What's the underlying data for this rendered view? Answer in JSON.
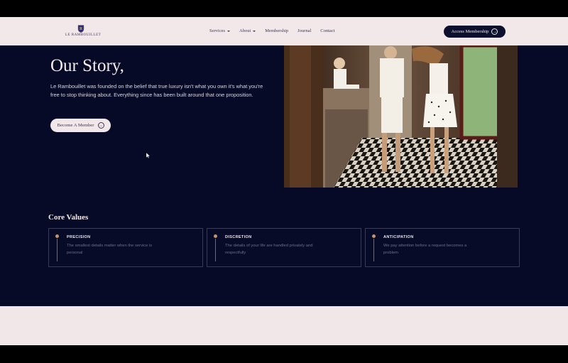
{
  "brand": {
    "crest_letter": "R",
    "logo_text": "LE RAMBOUILLET"
  },
  "nav": {
    "items": [
      {
        "label": "Services",
        "has_dropdown": true
      },
      {
        "label": "About",
        "has_dropdown": true
      },
      {
        "label": "Membership",
        "has_dropdown": false
      },
      {
        "label": "Journal",
        "has_dropdown": false
      },
      {
        "label": "Contact",
        "has_dropdown": false
      }
    ],
    "cta_label": "Access Membership",
    "cta_icon": "arrow-right-circle-icon"
  },
  "hero": {
    "title": "Our Story,",
    "text": "Le Rambouillet was founded on the belief that true luxury isn't what you own it's what you're free to stop thinking about. Everything since has been built around that one proposition.",
    "button_label": "Become A Member",
    "button_icon": "arrow-right-circle-icon"
  },
  "values": {
    "title": "Core Values",
    "cards": [
      {
        "title": "PRECISION",
        "text": "The smallest details matter when the service is personal"
      },
      {
        "title": "DISCRETION",
        "text": "The details of your life are handled privately and respectfully"
      },
      {
        "title": "ANTICIPATION",
        "text": "We pay attention before a request becomes a problem"
      }
    ]
  },
  "colors": {
    "navy": "#070a27",
    "blush": "#f1e7e8",
    "accent_gold": "#c49367",
    "card_border": "#373a59"
  }
}
